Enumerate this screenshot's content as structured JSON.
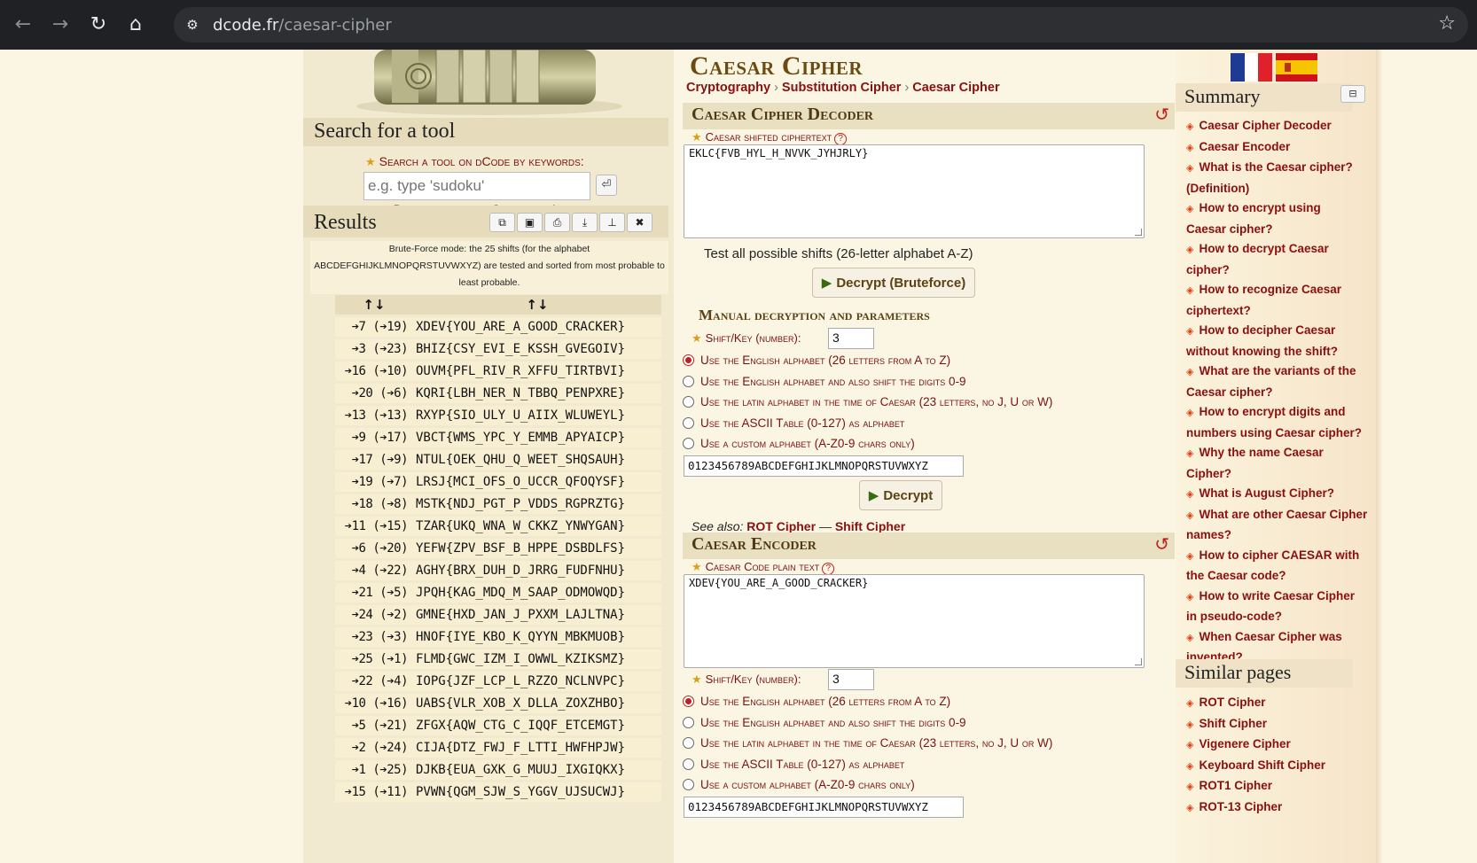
{
  "browser": {
    "url_domain": "dcode.fr",
    "url_path": "/caesar-cipher"
  },
  "left": {
    "search_title": "Search for a tool",
    "search_label": "Search a tool on dCode by keywords:",
    "search_placeholder": "e.g. type 'sudoku'",
    "browse_prefix": "Browse the",
    "browse_link": "full dCode tools' list",
    "results_title": "Results",
    "results_note": "Brute-Force mode: the 25 shifts (for the alphabet ABCDEFGHIJKLMNOPQRSTUVWXYZ) are tested and sorted from most probable to least probable.",
    "table_headers": [
      "↑↓",
      "↑↓"
    ],
    "results": [
      {
        "shift": "➔7 (➔19)",
        "text": "XDEV{YOU_ARE_A_GOOD_CRACKER}"
      },
      {
        "shift": "➔3 (➔23)",
        "text": "BHIZ{CSY_EVI_E_KSSH_GVEGOIV}"
      },
      {
        "shift": "➔16 (➔10)",
        "text": "OUVM{PFL_RIV_R_XFFU_TIRTBVI}"
      },
      {
        "shift": "➔20 (➔6)",
        "text": "KQRI{LBH_NER_N_TBBQ_PENPXRE}"
      },
      {
        "shift": "➔13 (➔13)",
        "text": "RXYP{SIO_ULY_U_AIIX_WLUWEYL}"
      },
      {
        "shift": "➔9 (➔17)",
        "text": "VBCT{WMS_YPC_Y_EMMB_APYAICP}"
      },
      {
        "shift": "➔17 (➔9)",
        "text": "NTUL{OEK_QHU_Q_WEET_SHQSAUH}"
      },
      {
        "shift": "➔19 (➔7)",
        "text": "LRSJ{MCI_OFS_O_UCCR_QFOQYSF}"
      },
      {
        "shift": "➔18 (➔8)",
        "text": "MSTK{NDJ_PGT_P_VDDS_RGPRZTG}"
      },
      {
        "shift": "➔11 (➔15)",
        "text": "TZAR{UKQ_WNA_W_CKKZ_YNWYGAN}"
      },
      {
        "shift": "➔6 (➔20)",
        "text": "YEFW{ZPV_BSF_B_HPPE_DSBDLFS}"
      },
      {
        "shift": "➔4 (➔22)",
        "text": "AGHY{BRX_DUH_D_JRRG_FUDFNHU}"
      },
      {
        "shift": "➔21 (➔5)",
        "text": "JPQH{KAG_MDQ_M_SAAP_ODMOWQD}"
      },
      {
        "shift": "➔24 (➔2)",
        "text": "GMNE{HXD_JAN_J_PXXM_LAJLTNA}"
      },
      {
        "shift": "➔23 (➔3)",
        "text": "HNOF{IYE_KBO_K_QYYN_MBKMUOB}"
      },
      {
        "shift": "➔25 (➔1)",
        "text": "FLMD{GWC_IZM_I_OWWL_KZIKSMZ}"
      },
      {
        "shift": "➔22 (➔4)",
        "text": "IOPG{JZF_LCP_L_RZZO_NCLNVPC}"
      },
      {
        "shift": "➔10 (➔16)",
        "text": "UABS{VLR_XOB_X_DLLA_ZOXZHBO}"
      },
      {
        "shift": "➔5 (➔21)",
        "text": "ZFGX{AQW_CTG_C_IQQF_ETCEMGT}"
      },
      {
        "shift": "➔2 (➔24)",
        "text": "CIJA{DTZ_FWJ_F_LTTI_HWFHPJW}"
      },
      {
        "shift": "➔1 (➔25)",
        "text": "DJKB{EUA_GXK_G_MUUJ_IXGIQKX}"
      },
      {
        "shift": "➔15 (➔11)",
        "text": "PVWN{QGM_SJW_S_YGGV_UJSUCWJ}"
      }
    ]
  },
  "center": {
    "title": "Caesar Cipher",
    "breadcrumb": [
      "Cryptography",
      "Substitution Cipher",
      "Caesar Cipher"
    ],
    "decoder": {
      "title": "Caesar Cipher Decoder",
      "field_label": "Caesar shifted ciphertext",
      "ciphertext": "EKLC{FVB_HYL_H_NVVK_JYHJRLY}",
      "test_all": "Test all possible shifts (26-letter alphabet A-Z)",
      "bruteforce_btn": "Decrypt (Bruteforce)",
      "manual_title": "Manual decryption and parameters",
      "shift_label": "Shift/Key (number):",
      "shift_value": "3",
      "options": [
        "Use the English alphabet (26 letters from A to Z)",
        "Use the English alphabet and also shift the digits 0-9",
        "Use the latin alphabet in the time of Caesar (23 letters, no J, U or W)",
        "Use the ASCII Table (0-127) as alphabet",
        "Use a custom alphabet (A-Z0-9 chars only)"
      ],
      "custom_alphabet": "0123456789ABCDEFGHIJKLMNOPQRSTUVWXYZ",
      "decrypt_btn": "Decrypt",
      "see_also": "See also:",
      "see_also_links": [
        "ROT Cipher",
        "Shift Cipher"
      ],
      "see_also_sep": "—"
    },
    "encoder": {
      "title": "Caesar Encoder",
      "field_label": "Caesar Code plain text",
      "plaintext": "XDEV{YOU_ARE_A_GOOD_CRACKER}",
      "shift_label": "Shift/Key (number):",
      "shift_value": "3",
      "options": [
        "Use the English alphabet (26 letters from A to Z)",
        "Use the English alphabet and also shift the digits 0-9",
        "Use the latin alphabet in the time of Caesar (23 letters, no J, U or W)",
        "Use the ASCII Table (0-127) as alphabet",
        "Use a custom alphabet (A-Z0-9 chars only)"
      ],
      "custom_alphabet": "0123456789ABCDEFGHIJKLMNOPQRSTUVWXYZ"
    }
  },
  "right": {
    "summary_title": "Summary",
    "summary": [
      "Caesar Cipher Decoder",
      "Caesar Encoder",
      "What is the Caesar cipher? (Definition)",
      "How to encrypt using Caesar cipher?",
      "How to decrypt Caesar cipher?",
      "How to recognize Caesar ciphertext?",
      "How to decipher Caesar without knowing the shift?",
      "What are the variants of the Caesar cipher?",
      "How to encrypt digits and numbers using Caesar cipher?",
      "Why the name Caesar Cipher?",
      "What is August Cipher?",
      "What are other Caesar Cipher names?",
      "How to cipher CAESAR with the Caesar code?",
      "How to write Caesar Cipher in pseudo-code?",
      "When Caesar Cipher was invented?"
    ],
    "similar_title": "Similar pages",
    "similar": [
      "ROT Cipher",
      "Shift Cipher",
      "Vigenere Cipher",
      "Keyboard Shift Cipher",
      "ROT1 Cipher",
      "ROT-13 Cipher"
    ]
  },
  "colors": {
    "accent_red": "#8a1010",
    "title_brown": "#6b4a14",
    "panel_bg": "#e9e0c2",
    "page_bg": "#fbf6e4"
  }
}
